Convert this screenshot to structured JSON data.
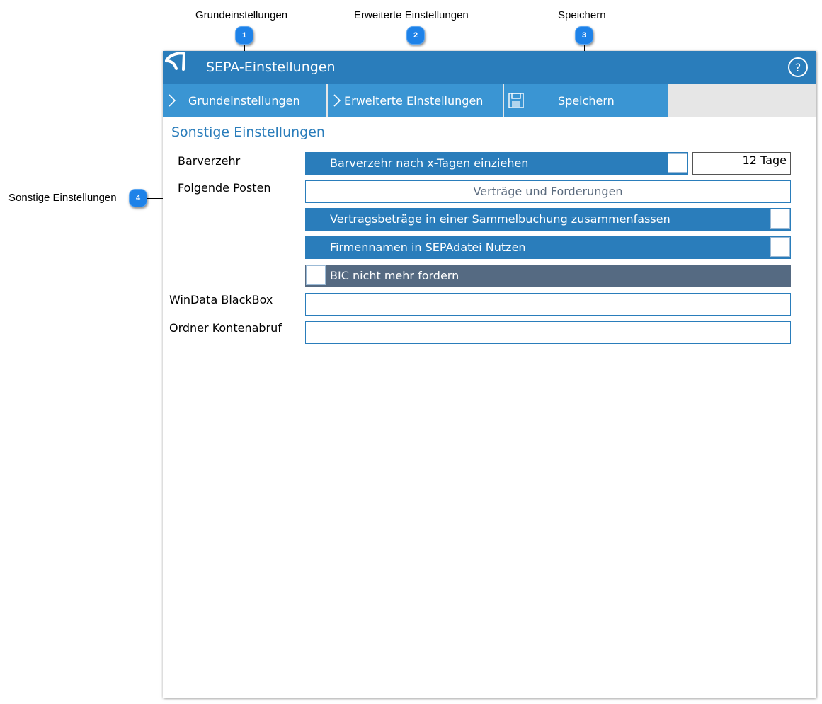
{
  "callouts": [
    {
      "num": "1",
      "label": "Grundeinstellungen"
    },
    {
      "num": "2",
      "label": "Erweiterte Einstellungen"
    },
    {
      "num": "3",
      "label": "Speichern"
    },
    {
      "num": "4",
      "label": "Sonstige Einstellungen"
    }
  ],
  "window": {
    "title": "SEPA-Einstellungen",
    "help_symbol": "?",
    "tabs": [
      {
        "label": "Grundeinstellungen",
        "icon": "chevron-right-icon"
      },
      {
        "label": "Erweiterte Einstellungen",
        "icon": "chevron-right-icon"
      },
      {
        "label": "Speichern",
        "icon": "floppy-disk-icon"
      }
    ]
  },
  "section": {
    "title": "Sonstige Einstellungen",
    "barverzehr_label": "Barverzehr",
    "barverzehr_toggle": "Barverzehr nach x-Tagen einziehen",
    "barverzehr_days": "12 Tage",
    "posten_label": "Folgende Posten",
    "posten_button": "Verträge und Forderungen",
    "sammelbuchung_toggle": "Vertragsbeträge in einer Sammelbuchung zusammenfassen",
    "firmennamen_toggle": "Firmennamen in SEPAdatei Nutzen",
    "bic_toggle": "BIC nicht mehr fordern",
    "blackbox_label": "WinData BlackBox",
    "blackbox_value": "",
    "ordner_label": "Ordner Kontenabruf",
    "ordner_value": ""
  },
  "colors": {
    "primary": "#2a7dbb",
    "tab": "#3a95d3",
    "dark_bar": "#556a82",
    "badge": "#1e82e8"
  }
}
